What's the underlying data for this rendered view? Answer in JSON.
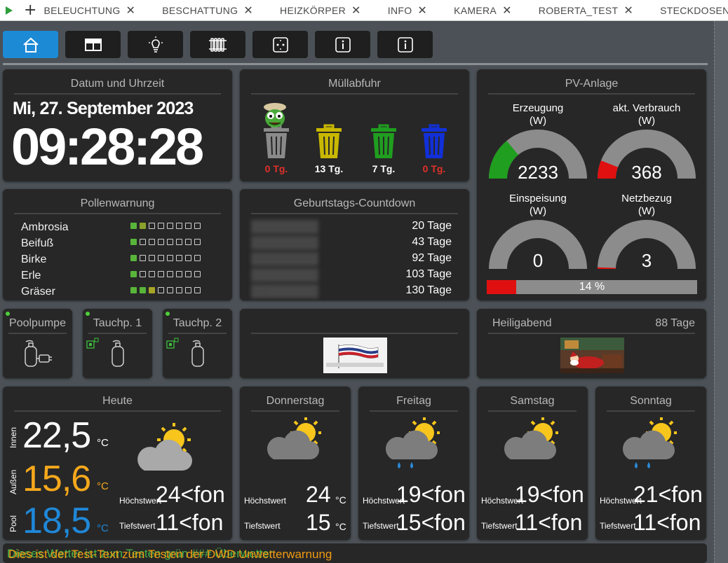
{
  "tabs": [
    {
      "label": "BELEUCHTUNG"
    },
    {
      "label": "BESCHATTUNG"
    },
    {
      "label": "HEIZKÖRPER"
    },
    {
      "label": "INFO"
    },
    {
      "label": "KAMERA"
    },
    {
      "label": "ROBERTA_TEST"
    },
    {
      "label": "STECKDOSEN"
    }
  ],
  "nav": {
    "buttons": [
      {
        "icon": "home-icon"
      },
      {
        "icon": "window-blind-icon"
      },
      {
        "icon": "light-bulb-icon"
      },
      {
        "icon": "radiator-icon"
      },
      {
        "icon": "power-socket-icon"
      },
      {
        "icon": "info-icon"
      },
      {
        "icon": "info-icon"
      }
    ]
  },
  "datetime": {
    "title": "Datum und Uhrzeit",
    "date": "Mi, 27. September 2023",
    "time": "09:28:28"
  },
  "waste": {
    "title": "Müllabfuhr",
    "bins": [
      {
        "label": "0 Tg.",
        "color": "#8a8a8a",
        "label_color": "#e0312a"
      },
      {
        "label": "13 Tg.",
        "color": "#c9b800",
        "label_color": "#ffffff"
      },
      {
        "label": "7 Tg.",
        "color": "#1f9e1f",
        "label_color": "#ffffff"
      },
      {
        "label": "0 Tg.",
        "color": "#1230d8",
        "label_color": "#e0312a"
      }
    ]
  },
  "pv": {
    "title": "PV-Anlage",
    "gauges": [
      {
        "title1": "Erzeugung",
        "title2": "(W)",
        "value": "2233",
        "fraction": 0.28,
        "fill": "#1f9e1f"
      },
      {
        "title1": "akt. Verbrauch",
        "title2": "(W)",
        "value": "368",
        "fraction": 0.12,
        "fill": "#e01010"
      },
      {
        "title1": "Einspeisung",
        "title2": "(W)",
        "value": "0",
        "fraction": 0.0,
        "fill": "#1f9e1f"
      },
      {
        "title1": "Netzbezug",
        "title2": "(W)",
        "value": "3",
        "fraction": 0.01,
        "fill": "#e01010"
      }
    ],
    "bar": {
      "label": "14 %",
      "fraction": 0.14
    }
  },
  "pollen": {
    "title": "Pollenwarnung",
    "rows": [
      {
        "name": "Ambrosia",
        "levels": [
          "g",
          "o",
          "e",
          "e",
          "e",
          "e",
          "e",
          "e"
        ]
      },
      {
        "name": "Beifuß",
        "levels": [
          "g",
          "e",
          "e",
          "e",
          "e",
          "e",
          "e",
          "e"
        ]
      },
      {
        "name": "Birke",
        "levels": [
          "g",
          "e",
          "e",
          "e",
          "e",
          "e",
          "e",
          "e"
        ]
      },
      {
        "name": "Erle",
        "levels": [
          "g",
          "e",
          "e",
          "e",
          "e",
          "e",
          "e",
          "e"
        ]
      },
      {
        "name": "Gräser",
        "levels": [
          "g",
          "g",
          "y",
          "e",
          "e",
          "e",
          "e",
          "e"
        ]
      }
    ]
  },
  "birthday": {
    "title": "Geburtstags-Countdown",
    "rows": [
      {
        "value": "20 Tage"
      },
      {
        "value": "43 Tage"
      },
      {
        "value": "92 Tage"
      },
      {
        "value": "103 Tage"
      },
      {
        "value": "130 Tage"
      }
    ]
  },
  "devices": [
    {
      "title": "Poolpumpe"
    },
    {
      "title": "Tauchp. 1"
    },
    {
      "title": "Tauchp. 2"
    }
  ],
  "christmas": {
    "title": "Heiligabend",
    "days": "88 Tage"
  },
  "weather_today": {
    "title": "Heute",
    "inside_label": "Innen",
    "outside_label": "Außen",
    "pool_label": "Pool",
    "inside": "22,5",
    "outside": "15,6",
    "pool": "18,5",
    "unit": "°C",
    "high_label": "Höchstwert",
    "low_label": "Tiefstwert",
    "high": "24<fon",
    "low": "11<fon"
  },
  "forecast": [
    {
      "title": "Donnerstag",
      "high": "24",
      "low": "15",
      "unit": "°C",
      "high_label": "Höchstwert",
      "low_label": "Tiefstwert",
      "rain": false
    },
    {
      "title": "Freitag",
      "high": "19<fon",
      "low": "15<fon",
      "unit": "",
      "high_label": "Höchstwert",
      "low_label": "Tiefstwert",
      "rain": true
    },
    {
      "title": "Samstag",
      "high": "19<fon",
      "low": "11<fon",
      "unit": "",
      "high_label": "Höchstwert",
      "low_label": "Tiefstwert",
      "rain": false
    },
    {
      "title": "Sonntag",
      "high": "21<fon",
      "low": "11<fon",
      "unit": "",
      "high_label": "Höchstwert",
      "low_label": "Tiefstwert",
      "rain": true
    }
  ],
  "marquee": {
    "text_green": "Dieses Wetter ist zum Testen grün ### Überwetter",
    "text_orange": "Dies ist der Test-Text zum Testen der DWD Unwetterwarnung"
  },
  "colors": {
    "accent": "#1d8ad6",
    "outside_temp": "#f5a81c",
    "pool_temp": "#1f88d8"
  }
}
